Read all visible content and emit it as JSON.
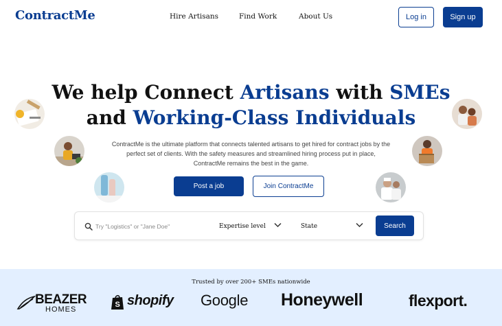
{
  "header": {
    "logo": "ContractMe",
    "nav": [
      {
        "label": "Hire Artisans"
      },
      {
        "label": "Find Work"
      },
      {
        "label": "About Us"
      }
    ],
    "login_label": "Log in",
    "signup_label": "Sign up"
  },
  "hero": {
    "title_part1": "We help Connect ",
    "title_accent1": "Artisans",
    "title_part2": " with ",
    "title_accent2": "SMEs",
    "title_part3": "and ",
    "title_accent3": "Working-Class Individuals",
    "description": "ContractMe is the ultimate platform that connects talented artisans to get hired for contract jobs by the perfect set of clients. With the safety measures and streamlined hiring process put in place, ContractMe remains the best in the game.",
    "post_job_label": "Post a job",
    "join_label": "Join ContractMe"
  },
  "search": {
    "placeholder": "Try \"Logistics\" or \"Jane Doe\"",
    "expertise_label": "Expertise level",
    "state_label": "State",
    "search_label": "Search"
  },
  "trust": {
    "text": "Trusted by over 200+ SMEs nationwide",
    "brands": {
      "beazer_top": "BEAZER",
      "beazer_bottom": "HOMES",
      "shopify": "shopify",
      "google": "Google",
      "honeywell": "Honeywell",
      "flexport": "flexport."
    }
  },
  "colors": {
    "primary": "#0a3d91",
    "band": "#e3efff"
  }
}
